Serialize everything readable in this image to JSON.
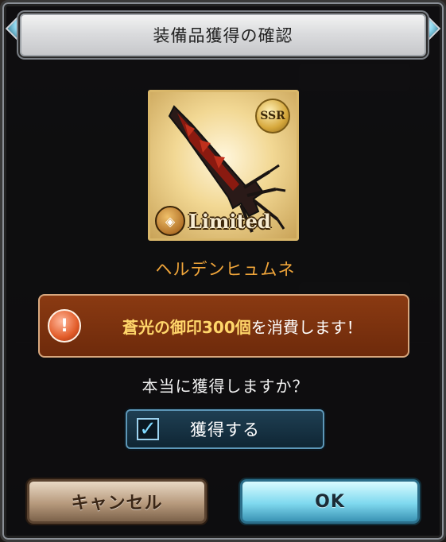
{
  "dialog": {
    "title": "装備品獲得の確認",
    "item": {
      "rarity": "SSR",
      "tag": "Limited",
      "name": "ヘルデンヒュムネ",
      "image_icon": "sword-icon"
    },
    "warning": {
      "icon": "exclamation-icon",
      "highlight": "蒼光の御印300個",
      "rest": "を消費します！"
    },
    "question": "本当に獲得しますか？",
    "acquire_label": "獲得する",
    "acquire_checked": true,
    "cancel_label": "キャンセル",
    "ok_label": "OK"
  },
  "colors": {
    "item_name": "#f0a53a",
    "warning_bg": "#7a300e",
    "highlight": "#ffd66a"
  }
}
